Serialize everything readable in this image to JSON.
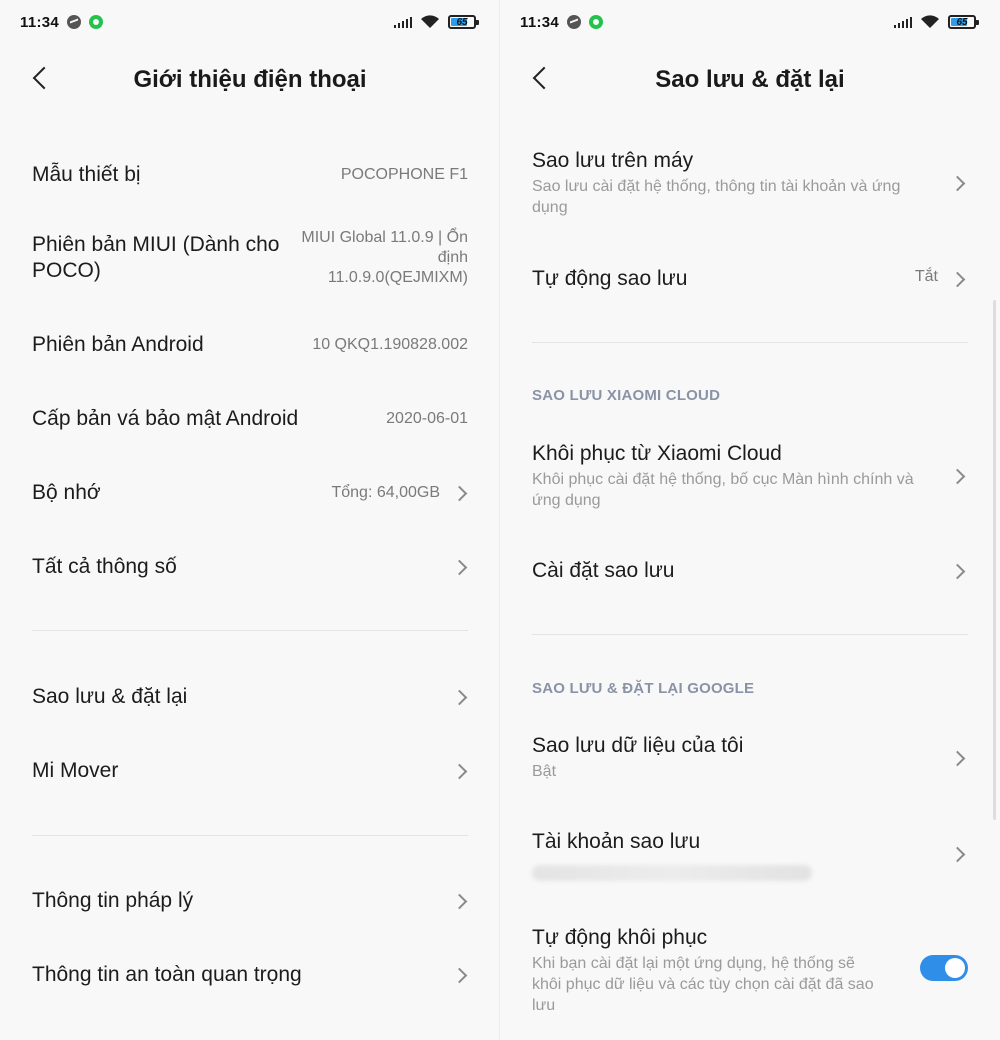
{
  "status_bar": {
    "time": "11:34",
    "battery": "65",
    "battery_level": 0.65
  },
  "left_screen": {
    "title": "Giới thiệu điện thoại",
    "rows": [
      {
        "label": "Mẫu thiết bị",
        "value": "POCOPHONE F1"
      },
      {
        "label": "Phiên bản MIUI (Dành cho POCO)",
        "value": "MIUI Global 11.0.9 | Ổn định 11.0.9.0(QEJMIXM)"
      },
      {
        "label": "Phiên bản Android",
        "value": "10 QKQ1.190828.002"
      },
      {
        "label": "Cấp bản vá bảo mật Android",
        "value": "2020-06-01"
      },
      {
        "label": "Bộ nhớ",
        "value": "Tổng: 64,00GB"
      },
      {
        "label": "Tất cả thông số",
        "value": ""
      },
      {
        "label": "Sao lưu & đặt lại",
        "value": ""
      },
      {
        "label": "Mi Mover",
        "value": ""
      },
      {
        "label": "Thông tin pháp lý",
        "value": ""
      },
      {
        "label": "Thông tin an toàn quan trọng",
        "value": ""
      }
    ]
  },
  "right_screen": {
    "title": "Sao lưu & đặt lại",
    "local_backup": {
      "title": "Sao lưu trên máy",
      "subtitle": "Sao lưu cài đặt hệ thống, thông tin tài khoản và ứng dụng"
    },
    "auto_backup": {
      "title": "Tự động sao lưu",
      "value": "Tắt"
    },
    "section_cloud": "SAO LƯU XIAOMI CLOUD",
    "restore_cloud": {
      "title": "Khôi phục từ Xiaomi Cloud",
      "subtitle": "Khôi phục cài đặt hệ thống, bố cục Màn hình chính và ứng dụng"
    },
    "backup_settings": {
      "title": "Cài đặt sao lưu"
    },
    "section_google": "SAO LƯU & ĐẶT LẠI GOOGLE",
    "backup_my_data": {
      "title": "Sao lưu dữ liệu của tôi",
      "subtitle": "Bật"
    },
    "backup_account": {
      "title": "Tài khoản sao lưu"
    },
    "auto_restore": {
      "title": "Tự động khôi phục",
      "subtitle": "Khi bạn cài đặt lại một ứng dụng, hệ thống sẽ khôi phục dữ liệu và các tùy chọn cài đặt đã sao lưu",
      "enabled": true
    }
  },
  "colors": {
    "accent": "#2f8fe8",
    "section_label": "#8a93a6",
    "background": "#f8f8f8"
  }
}
